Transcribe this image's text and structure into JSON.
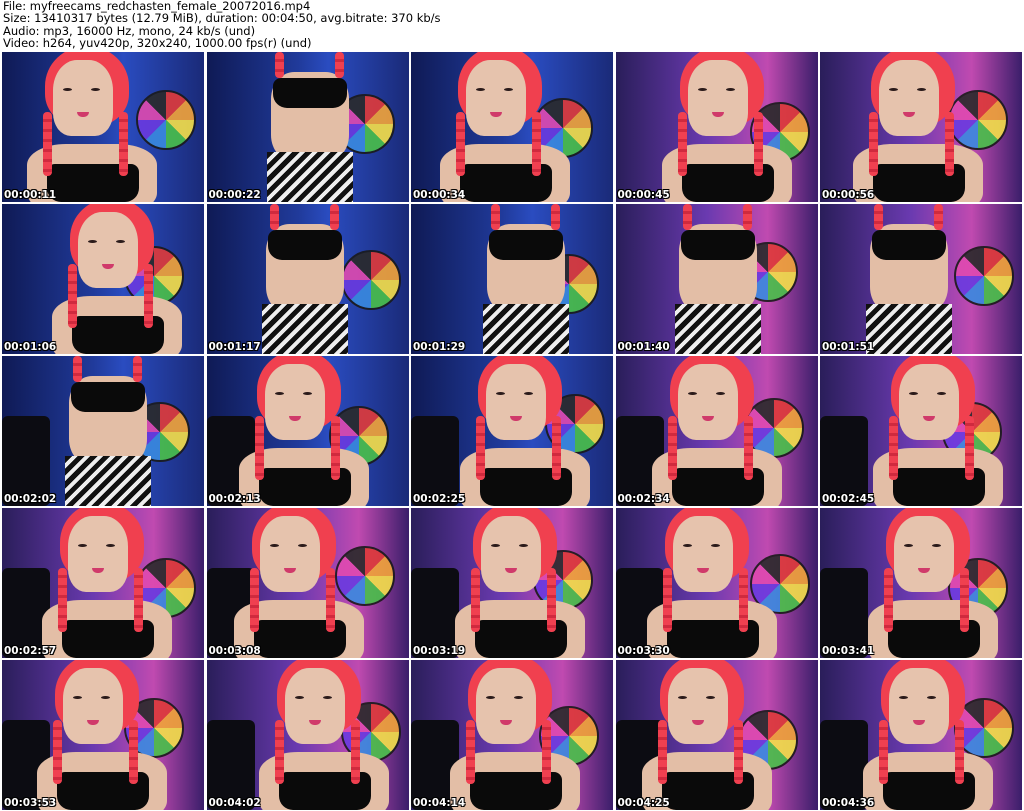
{
  "header": {
    "lines": [
      "File: myfreecams_redchasten_female_20072016.mp4",
      "Size: 13410317 bytes (12.79 MiB), duration: 00:04:50, avg.bitrate: 370 kb/s",
      "Audio: mp3, 16000 Hz, mono, 24 kb/s (und)",
      "Video: h264, yuv420p, 320x240, 1000.00 fps(r) (und)"
    ]
  },
  "thumbnails": [
    {
      "time": "00:00:11",
      "shot": "close"
    },
    {
      "time": "00:00:22",
      "shot": "body"
    },
    {
      "time": "00:00:34",
      "shot": "close"
    },
    {
      "time": "00:00:45",
      "shot": "close"
    },
    {
      "time": "00:00:56",
      "shot": "close"
    },
    {
      "time": "00:01:06",
      "shot": "close"
    },
    {
      "time": "00:01:17",
      "shot": "body"
    },
    {
      "time": "00:01:29",
      "shot": "body"
    },
    {
      "time": "00:01:40",
      "shot": "body"
    },
    {
      "time": "00:01:51",
      "shot": "body"
    },
    {
      "time": "00:02:02",
      "shot": "body"
    },
    {
      "time": "00:02:13",
      "shot": "close"
    },
    {
      "time": "00:02:25",
      "shot": "close"
    },
    {
      "time": "00:02:34",
      "shot": "close"
    },
    {
      "time": "00:02:45",
      "shot": "close"
    },
    {
      "time": "00:02:57",
      "shot": "close"
    },
    {
      "time": "00:03:08",
      "shot": "close"
    },
    {
      "time": "00:03:19",
      "shot": "close"
    },
    {
      "time": "00:03:30",
      "shot": "close"
    },
    {
      "time": "00:03:41",
      "shot": "close"
    },
    {
      "time": "00:03:53",
      "shot": "close"
    },
    {
      "time": "00:04:02",
      "shot": "close"
    },
    {
      "time": "00:04:14",
      "shot": "close"
    },
    {
      "time": "00:04:25",
      "shot": "close"
    },
    {
      "time": "00:04:36",
      "shot": "close"
    }
  ]
}
